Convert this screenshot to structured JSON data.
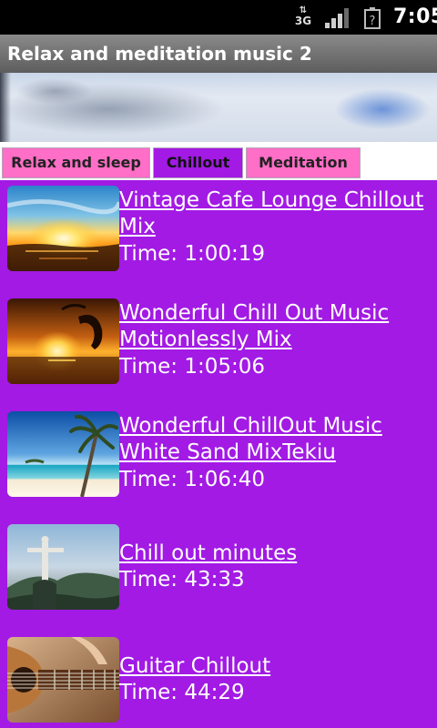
{
  "status_bar": {
    "network": "3G",
    "signal_icon": "signal-bars-icon",
    "battery_icon": "battery-unknown-icon",
    "time": "7:05"
  },
  "app": {
    "title": "Relax and meditation music 2"
  },
  "ad_banner": {
    "icon": "ad-banner"
  },
  "tabs": [
    {
      "label": "Relax and sleep",
      "active": false
    },
    {
      "label": "Chillout",
      "active": true
    },
    {
      "label": "Meditation",
      "active": false
    }
  ],
  "tracks": [
    {
      "title": "Vintage Cafe Lounge Chillout Mix ",
      "time": "Time: 1:00:19",
      "thumb": "sunset-ocean-thumb"
    },
    {
      "title": "Wonderful Chill Out Music Motionlessly Mix",
      "time": "Time: 1:05:06",
      "thumb": "dolphin-sunset-thumb"
    },
    {
      "title": "Wonderful ChillOut Music White Sand MixTekiu",
      "time": "Time: 1:06:40",
      "thumb": "palm-beach-thumb"
    },
    {
      "title": "Chill out minutes",
      "time": "Time: 43:33",
      "thumb": "christ-redeemer-thumb"
    },
    {
      "title": "Guitar Chillout",
      "time": "Time: 44:29",
      "thumb": "guitar-thumb"
    }
  ],
  "colors": {
    "list_background": "#a21ae4",
    "tab_inactive": "#ff6ec7",
    "tab_active": "#a21ae4",
    "title_bar": "#6f6f6f",
    "text": "#ffffff"
  }
}
